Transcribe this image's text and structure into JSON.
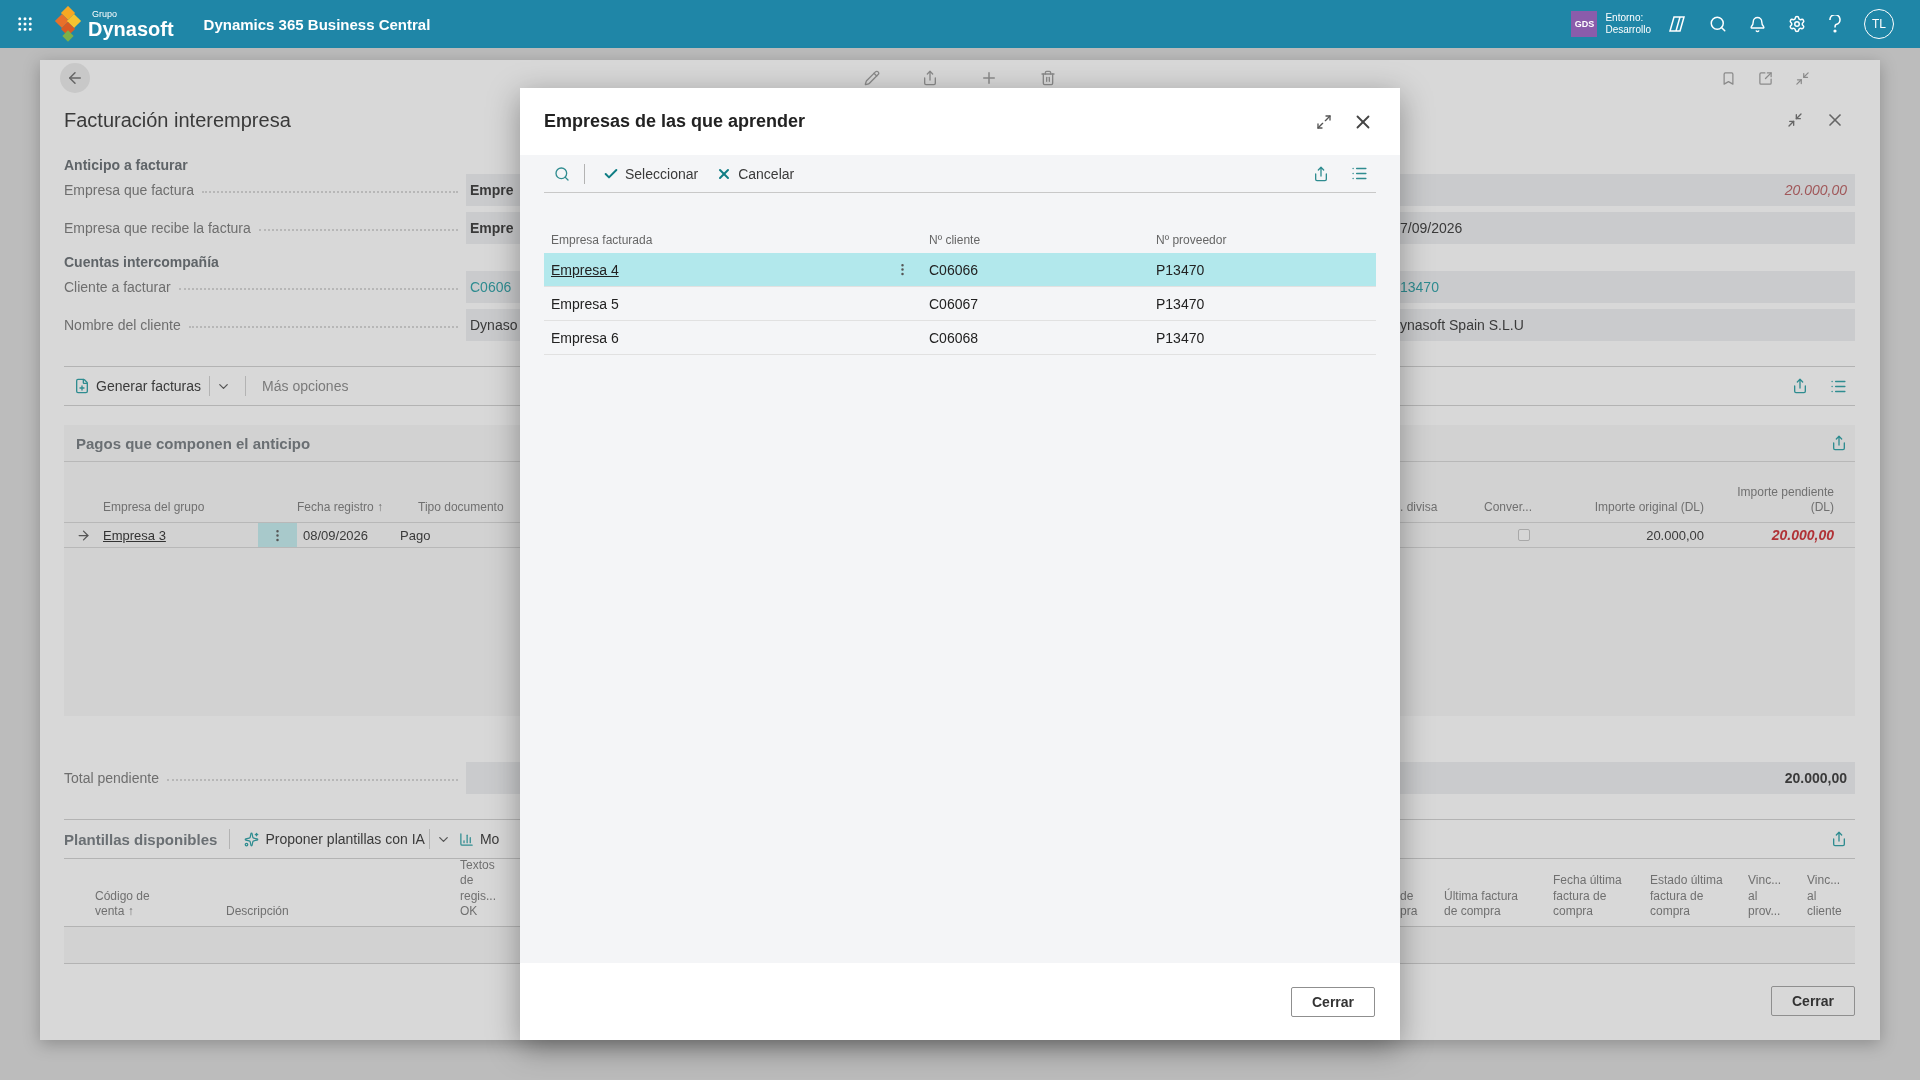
{
  "top_bar": {
    "logo_caption": "Grupo",
    "logo_name": "Dynasoft",
    "product": "Dynamics 365 Business Central",
    "environment_badge": "GDS",
    "environment_label": "Entorno:",
    "environment_name": "Desarrollo",
    "avatar_initials": "TL"
  },
  "page": {
    "title": "Facturación interempresa",
    "groups": [
      {
        "heading": "Anticipo a facturar",
        "fields": [
          {
            "label": "Empresa que factura",
            "start": {
              "text": "Empre",
              "kind": "bold"
            },
            "end": {
              "text": "20.000,00",
              "kind": "amount"
            }
          },
          {
            "label": "Empresa que recibe la factura",
            "start": {
              "text": "Empre",
              "kind": "bold"
            },
            "end": {
              "text": "7/09/2026",
              "kind": "plain"
            }
          }
        ]
      },
      {
        "heading": "Cuentas intercompañía",
        "fields": [
          {
            "label": "Cliente a facturar",
            "start": {
              "text": "C0606",
              "kind": "link"
            },
            "end": {
              "text": "13470",
              "kind": "link"
            }
          },
          {
            "label": "Nombre del cliente",
            "start": {
              "text": "Dynaso",
              "kind": "plain"
            },
            "end": {
              "text": "ynasoft Spain S.L.U",
              "kind": "plain"
            }
          }
        ]
      }
    ],
    "actions": [
      {
        "label": "Generar facturas",
        "kind": "split"
      },
      {
        "label": "Más opciones",
        "kind": "more"
      }
    ],
    "payments": {
      "title": "Pagos que componen el anticipo",
      "columns_start": [
        "Empresa del grupo",
        "Fecha registro ↑",
        "Tipo documento"
      ],
      "columns_end": [
        ". divisa",
        "Conver...",
        "Importe original (DL)",
        "Importe pendiente (DL)"
      ],
      "rows": [
        {
          "company": "Empresa 3",
          "date": "08/09/2026",
          "type": "Pago",
          "converted": false,
          "original": "20.000,00",
          "pending": "20.000,00",
          "selected": true
        }
      ]
    },
    "total": {
      "label": "Total pendiente",
      "end": {
        "text": "20.000,00",
        "kind": "bold"
      }
    },
    "templates": {
      "title": "Plantillas disponibles",
      "actions": [
        {
          "label": "Proponer plantillas con IA",
          "kind": "ai"
        },
        {
          "label": "Mo",
          "kind": "chart"
        }
      ],
      "columns_start": [
        "Código de venta ↑",
        "Descripción",
        "Textos de regis... OK"
      ],
      "columns_end": [
        "de pra",
        "Última factura de compra",
        "Fecha última factura de compra",
        "Estado última factura de compra",
        "Vinc... al prov...",
        "Vinc... al cliente"
      ]
    },
    "close_button": "Cerrar"
  },
  "dialog": {
    "title": "Empresas de las que aprender",
    "actions": [
      {
        "label": "Seleccionar",
        "kind": "select"
      },
      {
        "label": "Cancelar",
        "kind": "cancel"
      }
    ],
    "columns": [
      "Empresa facturada",
      "Nº cliente",
      "Nº proveedor"
    ],
    "rows": [
      {
        "company": "Empresa 4",
        "customer": "C06066",
        "vendor": "P13470",
        "selected": true
      },
      {
        "company": "Empresa 5",
        "customer": "C06067",
        "vendor": "P13470",
        "selected": false
      },
      {
        "company": "Empresa 6",
        "customer": "C06068",
        "vendor": "P13470",
        "selected": false
      }
    ],
    "close_button": "Cerrar"
  }
}
